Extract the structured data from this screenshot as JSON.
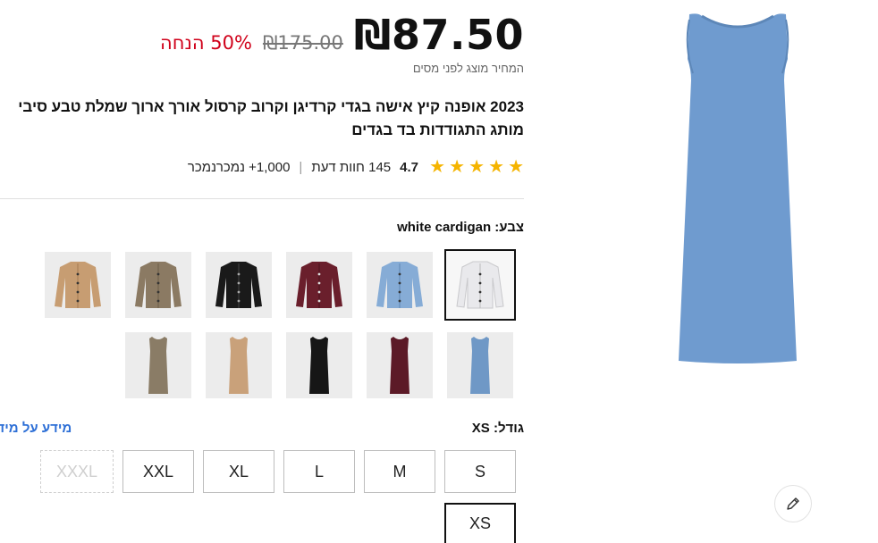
{
  "price": {
    "current": "₪87.50",
    "original": "₪175.00",
    "discount": "50% הנחה",
    "tax_note": "המחיר מוצג לפני מסים"
  },
  "product": {
    "title": "2023 אופנה קיץ אישה בגדי קרדיגן וקרוב קרסול אורך ארוך שמלת טבע סיבי מותג התגודדות בד בגדים"
  },
  "rating": {
    "stars": 5,
    "value": "4.7",
    "reviews": "145 חוות דעת",
    "separator": "|",
    "sold": "1,000+ נמכרנמכר"
  },
  "color": {
    "label": "צבע:",
    "selected": "white cardigan",
    "swatches_row1": [
      {
        "name": "white cardigan",
        "color": "#e9e9ec",
        "kind": "cardigan"
      },
      {
        "name": "blue cardigan",
        "color": "#86acd6",
        "kind": "cardigan"
      },
      {
        "name": "burgundy cardigan",
        "color": "#6a1f2c",
        "kind": "cardigan"
      },
      {
        "name": "black cardigan",
        "color": "#1a1a1a",
        "kind": "cardigan"
      },
      {
        "name": "khaki cardigan",
        "color": "#8b7a63",
        "kind": "cardigan"
      },
      {
        "name": "camel cardigan",
        "color": "#c79d72",
        "kind": "cardigan"
      }
    ],
    "swatches_row2": [
      {
        "name": "blue dress",
        "color": "#6f98c6",
        "kind": "dress"
      },
      {
        "name": "burgundy dress",
        "color": "#5c1a27",
        "kind": "dress"
      },
      {
        "name": "black dress",
        "color": "#161616",
        "kind": "dress"
      },
      {
        "name": "camel dress",
        "color": "#c9a17a",
        "kind": "dress"
      },
      {
        "name": "khaki dress",
        "color": "#8a7c66",
        "kind": "dress"
      }
    ]
  },
  "size": {
    "label": "גודל:",
    "selected": "XS",
    "info_link": "מידע על מידו",
    "options": [
      "S",
      "M",
      "L",
      "XL",
      "XXL",
      "XXXL",
      "XS"
    ]
  },
  "image": {
    "main_color": "#6f9bcf"
  },
  "icons": {
    "edit": "pencil-icon",
    "star": "star-icon"
  }
}
